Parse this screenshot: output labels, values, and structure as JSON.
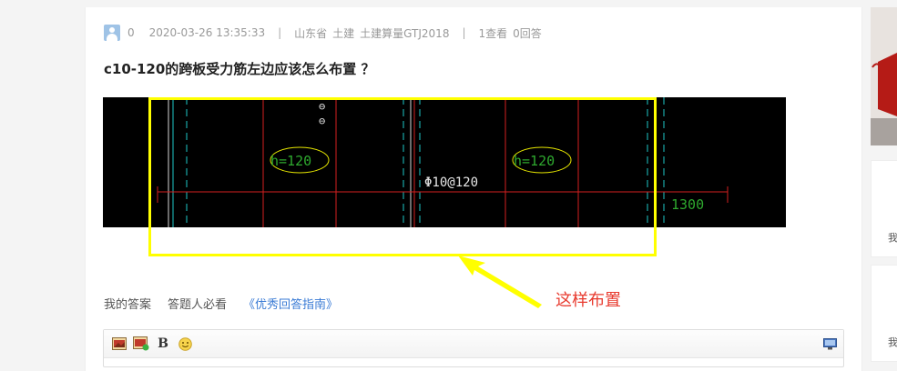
{
  "question": {
    "points": "0",
    "datetime": "2020-03-26 13:35:33",
    "separator": "|",
    "region": "山东省",
    "category": "土建",
    "software": "土建算量GTJ2018",
    "views": "1查看",
    "answers": "0回答",
    "title": "c10-120的跨板受力筋左边应该怎么布置 ？"
  },
  "drawing": {
    "left_label": "h=120",
    "right_label": "h=120",
    "rebar_label": "Φ10@120",
    "dimension": "1300",
    "vertical_mark": "⊖"
  },
  "annotation": {
    "text": "这样布置"
  },
  "answer_bar": {
    "my_answer": "我的答案",
    "must_read": "答题人必看",
    "guide_link": "《优秀回答指南》"
  },
  "side": {
    "card1_text": "我",
    "card2_text": "我"
  },
  "colors": {
    "highlight": "#ffff00",
    "annotation": "#e83a2e",
    "link": "#3a7bd5",
    "cad_background": "#000000"
  }
}
